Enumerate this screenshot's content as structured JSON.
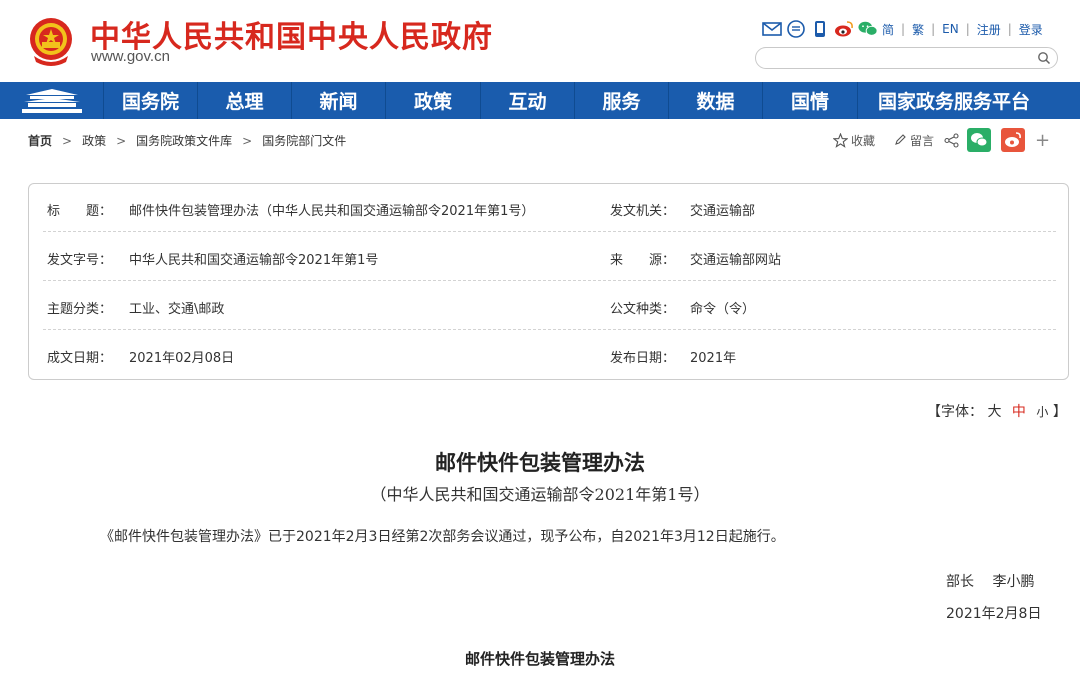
{
  "header": {
    "site_title": "中华人民共和国中央人民政府",
    "site_domain": "www.gov.cn",
    "links": [
      "简",
      "繁",
      "EN",
      "注册",
      "登录"
    ],
    "search_placeholder": "",
    "icons": [
      "mail-icon",
      "chat-icon",
      "mobile-icon",
      "weibo-icon",
      "wechat-icon"
    ],
    "brand_red": "#d7281e",
    "nav_blue": "#1a5cad"
  },
  "nav": {
    "items": [
      "国务院",
      "总理",
      "新闻",
      "政策",
      "互动",
      "服务",
      "数据",
      "国情",
      "国家政务服务平台"
    ]
  },
  "breadcrumb": {
    "items": [
      "首页",
      "政策",
      "国务院政策文件库",
      "国务院部门文件"
    ]
  },
  "share": {
    "favorite_label": "收藏",
    "comment_label": "留言",
    "plus": "+"
  },
  "info": {
    "rows": [
      {
        "l1": "标　　题：",
        "v1": "邮件快件包装管理办法（中华人民共和国交通运输部令2021年第1号）",
        "l2": "发文机关：",
        "v2": "交通运输部"
      },
      {
        "l1": "发文字号：",
        "v1": "中华人民共和国交通运输部令2021年第1号",
        "l2": "来　　源：",
        "v2": "交通运输部网站"
      },
      {
        "l1": "主题分类：",
        "v1": "工业、交通\\邮政",
        "l2": "公文种类：",
        "v2": "命令（令）"
      },
      {
        "l1": "成文日期：",
        "v1": "2021年02月08日",
        "l2": "发布日期：",
        "v2": "2021年"
      }
    ]
  },
  "font_size": {
    "prefix": "【字体：",
    "large": "大",
    "medium": "中",
    "small": "小",
    "suffix": "】"
  },
  "article": {
    "title": "邮件快件包装管理办法",
    "subtitle": "（中华人民共和国交通运输部令2021年第1号）",
    "paragraph": "《邮件快件包装管理办法》已于2021年2月3日经第2次部务会议通过，现予公布，自2021年3月12日起施行。",
    "signature_title": "部长",
    "signature_name": "李小鹏",
    "signature_date": "2021年2月8日",
    "heading2": "邮件快件包装管理办法"
  }
}
